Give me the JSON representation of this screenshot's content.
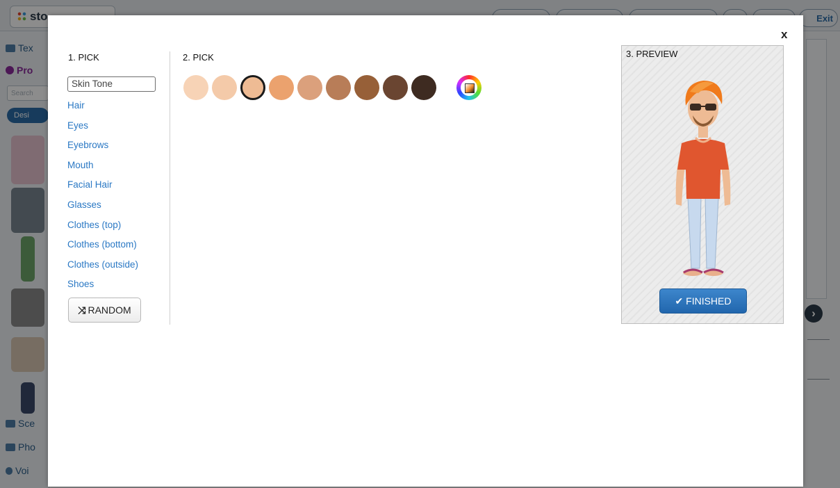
{
  "background_app": {
    "logo_text": "sto",
    "exit_label": "Exit",
    "sidebar_tabs": [
      "Tex",
      "Pro",
      "Sce",
      "Pho",
      "Voi"
    ],
    "search_placeholder": "Search",
    "design_label": "Desi",
    "next_icon": "chevron-right-icon"
  },
  "modal": {
    "close_label": "x",
    "step1": {
      "heading": "1. PICK",
      "items": [
        "Skin Tone",
        "Hair",
        "Eyes",
        "Eyebrows",
        "Mouth",
        "Facial Hair",
        "Glasses",
        "Clothes (top)",
        "Clothes (bottom)",
        "Clothes (outside)",
        "Shoes"
      ],
      "selected": "Skin Tone",
      "random_label": "RANDOM",
      "random_icon": "shuffle-icon"
    },
    "step2": {
      "heading": "2. PICK",
      "swatches": [
        "#f7d3b6",
        "#f4caa9",
        "#eebb94",
        "#eba26e",
        "#dba07c",
        "#b87d58",
        "#976038",
        "#6a4531",
        "#3e2b21"
      ],
      "selected_index": 2,
      "custom_color_icon": "color-wheel-icon"
    },
    "step3": {
      "heading": "3. PREVIEW",
      "finished_label": "FINISHED",
      "finished_icon": "check-icon"
    }
  }
}
